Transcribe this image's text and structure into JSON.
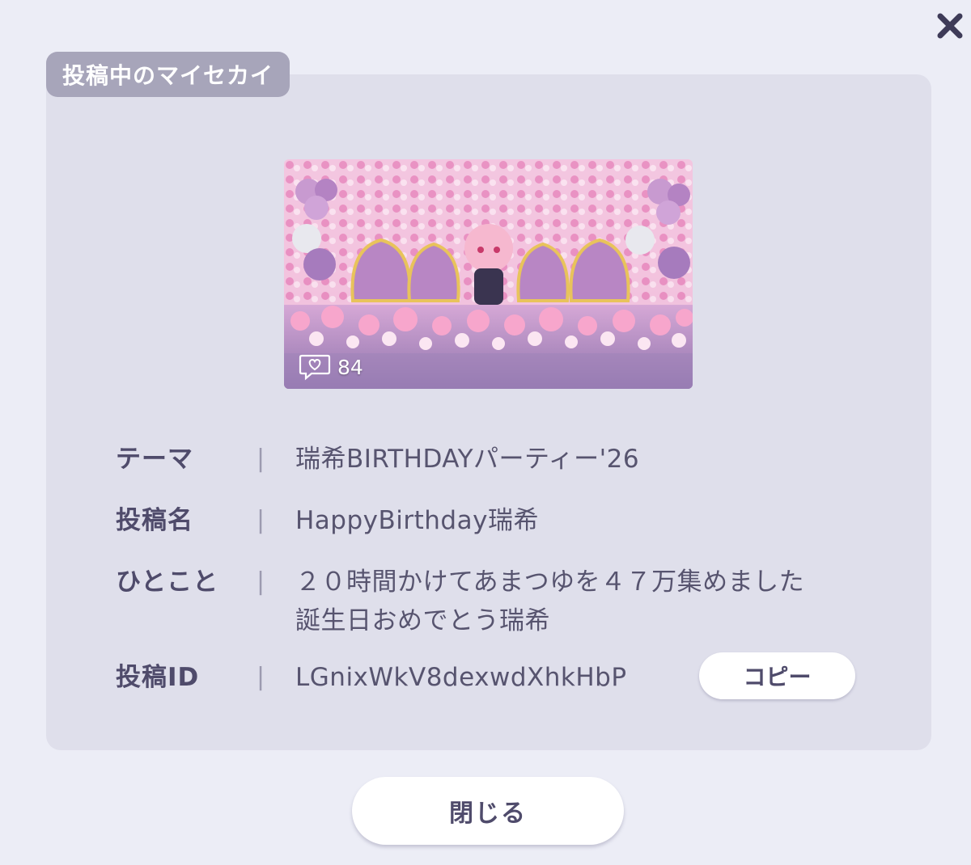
{
  "dialog": {
    "close_icon": "close-x-icon",
    "section_tab": "投稿中のマイセカイ"
  },
  "post": {
    "like_icon": "heart-speech-bubble-icon",
    "like_count": "84",
    "theme_label": "テーマ",
    "theme_value": "瑞希BIRTHDAYパーティー'26",
    "title_label": "投稿名",
    "title_value": "HappyBirthday瑞希",
    "comment_label": "ひとこと",
    "comment_value": "２０時間かけてあまつゆを４７万集めました\n誕生日おめでとう瑞希",
    "id_label": "投稿ID",
    "id_value": "LGnixWkV8dexwdXhkHbP",
    "separator": "|"
  },
  "buttons": {
    "copy_label": "コピー",
    "close_label": "閉じる"
  },
  "colors": {
    "background": "#ecedf6",
    "panel": "#dfdfeb",
    "tab": "#a7a5ba",
    "text_dark": "#4f4b6b"
  }
}
